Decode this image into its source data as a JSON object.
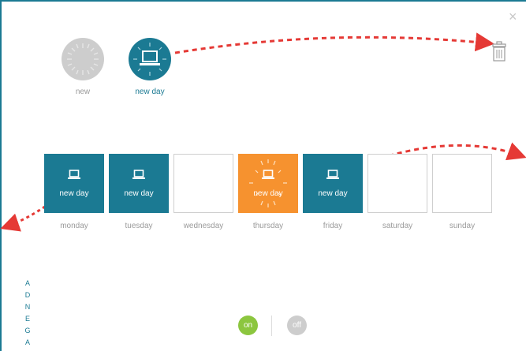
{
  "colors": {
    "teal": "#1b7a93",
    "orange": "#f6922f",
    "grey": "#cdcdcd",
    "green": "#8cc63f",
    "arrow": "#e53935"
  },
  "templates": [
    {
      "label": "new",
      "icon": "clock-icon",
      "active": false
    },
    {
      "label": "new day",
      "icon": "laptop-icon",
      "active": true
    }
  ],
  "trash_icon": "trash-icon",
  "close_label": "×",
  "week": [
    {
      "day": "monday",
      "text": "new day",
      "state": "blue"
    },
    {
      "day": "tuesday",
      "text": "new day",
      "state": "blue"
    },
    {
      "day": "wednesday",
      "text": "",
      "state": "empty"
    },
    {
      "day": "thursday",
      "text": "new day",
      "state": "orange"
    },
    {
      "day": "friday",
      "text": "new day",
      "state": "blue"
    },
    {
      "day": "saturday",
      "text": "",
      "state": "empty"
    },
    {
      "day": "sunday",
      "text": "",
      "state": "empty"
    }
  ],
  "agenda_letters": [
    "A",
    "G",
    "E",
    "N",
    "D",
    "A"
  ],
  "toggle": {
    "on": "on",
    "off": "off"
  }
}
